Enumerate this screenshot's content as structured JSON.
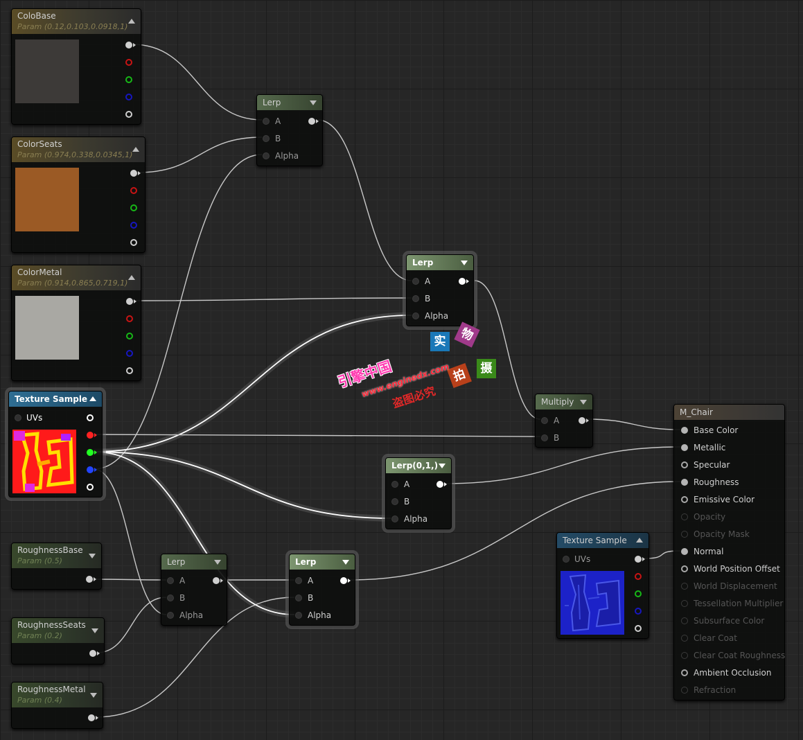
{
  "colors": {
    "colobase_swatch": "#3d3a38",
    "colorseats_swatch": "#9b5a25",
    "colormetal_swatch": "#a9a8a3",
    "wire": "#c8c8c8"
  },
  "params": {
    "colobase": {
      "title": "ColoBase",
      "sub": "Param (0.12,0.103,0.0918,1)"
    },
    "colorseats": {
      "title": "ColorSeats",
      "sub": "Param (0.974,0.338,0.0345,1)"
    },
    "colormetal": {
      "title": "ColorMetal",
      "sub": "Param (0.914,0.865,0.719,1)"
    },
    "roughness_base": {
      "title": "RoughnessBase",
      "sub": "Param (0.5)"
    },
    "roughness_seats": {
      "title": "RoughnessSeats",
      "sub": "Param (0.2)"
    },
    "roughness_metal": {
      "title": "RoughnessMetal",
      "sub": "Param (0.4)"
    }
  },
  "lerp": {
    "title": "Lerp",
    "a": "A",
    "b": "B",
    "alpha": "Alpha"
  },
  "lerp01": {
    "title": "Lerp(0,1,)"
  },
  "multiply": {
    "title": "Multiply",
    "a": "A",
    "b": "B"
  },
  "texture_sample": {
    "title": "Texture Sample",
    "uvs": "UVs"
  },
  "material": {
    "title": "M_Chair",
    "pins": [
      "Base Color",
      "Metallic",
      "Specular",
      "Roughness",
      "Emissive Color",
      "Opacity",
      "Opacity Mask",
      "Normal",
      "World Position Offset",
      "World Displacement",
      "Tessellation Multiplier",
      "Subsurface Color",
      "Clear Coat",
      "Clear Coat Roughness",
      "Ambient Occlusion",
      "Refraction"
    ]
  },
  "watermark": {
    "c1": "实",
    "c2": "物",
    "c3": "拍",
    "c4": "摄",
    "brand": "引擎中国",
    "url": "www.enginedx.com",
    "notice": "盗图必究"
  }
}
